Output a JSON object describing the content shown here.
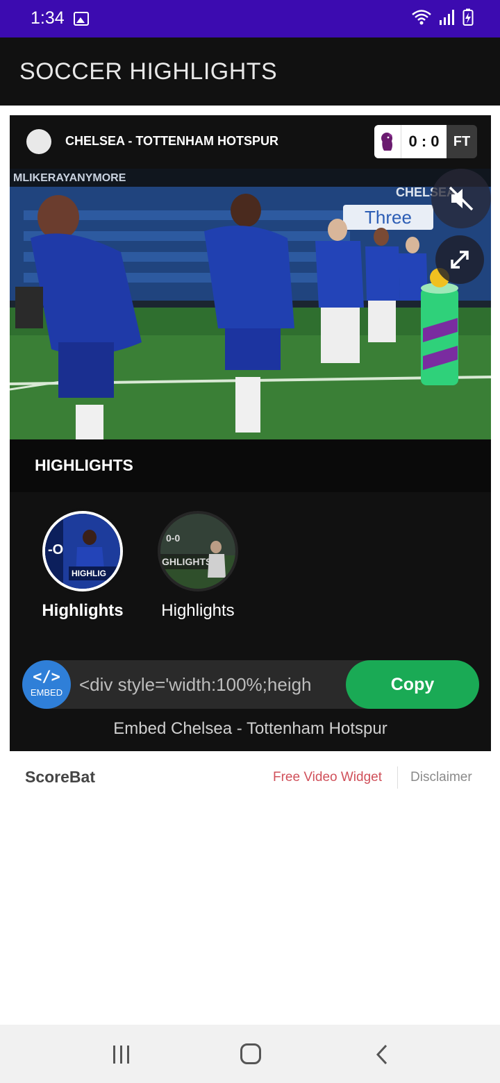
{
  "status_bar": {
    "time": "1:34"
  },
  "app_bar": {
    "title": "SOCCER HIGHLIGHTS"
  },
  "match": {
    "title": "CHELSEA - TOTTENHAM HOTSPUR",
    "score": "0 : 0",
    "status": "FT"
  },
  "video": {
    "overlay_texts": [
      "MLIKERAYANYMORE",
      "CHELSEA",
      "Three"
    ]
  },
  "highlights": {
    "section_title": "HIGHLIGHTS",
    "clips": [
      {
        "label": "Highlights",
        "thumb_text": "HIGHLIG",
        "selected": true
      },
      {
        "label": "Highlights",
        "thumb_text": "GHLIGHTS",
        "selected": false
      }
    ]
  },
  "embed": {
    "icon_label": "EMBED",
    "code_preview": "<div style='width:100%;heigh",
    "copy_label": "Copy",
    "caption": "Embed Chelsea - Tottenham Hotspur"
  },
  "footer": {
    "brand": "ScoreBat",
    "link_free_widget": "Free Video Widget",
    "link_disclaimer": "Disclaimer"
  },
  "colors": {
    "status_bar": "#3c0bb0",
    "app_bar": "#111111",
    "copy_button": "#1aaa55",
    "embed_icon": "#2f7fd8",
    "free_widget_link": "#d0505a"
  }
}
